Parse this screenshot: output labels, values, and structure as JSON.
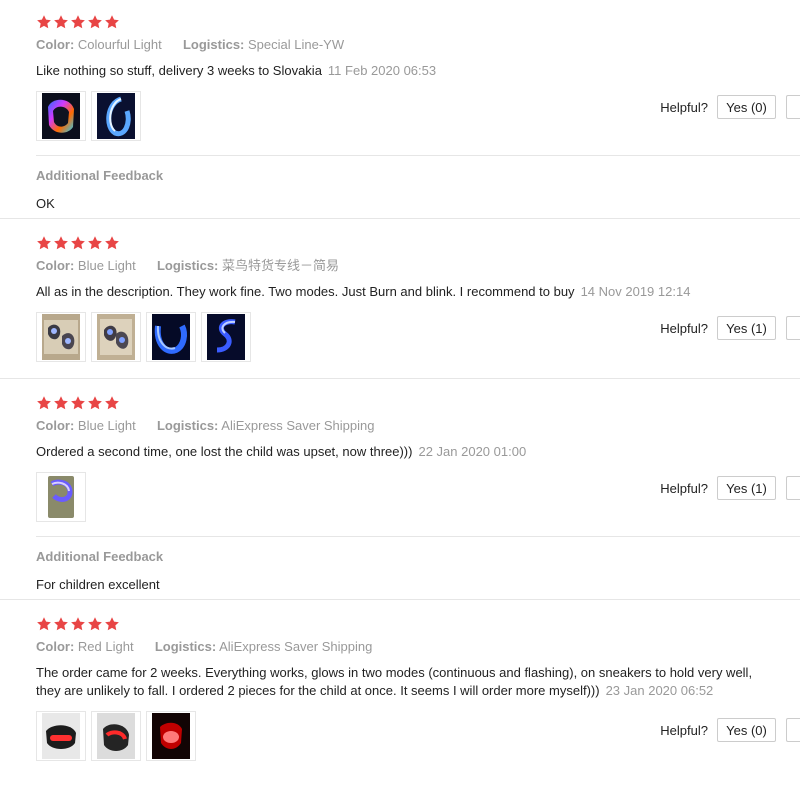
{
  "colors": {
    "star": "#e84545",
    "muted": "#999999",
    "text": "#222222",
    "border": "#e6e6e6"
  },
  "icons": {
    "rating": "star-icon"
  },
  "reviews": [
    {
      "stars": 5,
      "color_label": "Color:",
      "color_value": "Colourful Light",
      "logistics_label": "Logistics:",
      "logistics_value": "Special Line-YW",
      "text": "Like nothing so stuff, delivery 3 weeks to Slovakia",
      "date": "11 Feb 2020 06:53",
      "photos": [
        "rainbow-light-clip-photo",
        "blue-light-clip-photo"
      ],
      "helpful_label": "Helpful?",
      "yes_label": "Yes (0)",
      "additional_title": "Additional Feedback",
      "additional_text": "OK"
    },
    {
      "stars": 5,
      "color_label": "Color:",
      "color_value": "Blue Light",
      "logistics_label": "Logistics:",
      "logistics_value": "菜鸟特货专线－简易",
      "text": "All as in the description. They work fine. Two modes. Just Burn and blink. I recommend to buy",
      "date": "14 Nov 2019 12:14",
      "photos": [
        "packaged-clips-photo",
        "packaged-clips-photo-2",
        "blue-glow-dark-photo",
        "blue-glow-curl-photo"
      ],
      "helpful_label": "Helpful?",
      "yes_label": "Yes (1)"
    },
    {
      "stars": 5,
      "color_label": "Color:",
      "color_value": "Blue Light",
      "logistics_label": "Logistics:",
      "logistics_value": "AliExpress Saver Shipping",
      "text": "Ordered a second time, one lost the child was upset, now three)))",
      "date": "22 Jan 2020 01:00",
      "photos": [
        "blue-clip-on-phone-photo"
      ],
      "helpful_label": "Helpful?",
      "yes_label": "Yes (1)",
      "additional_title": "Additional Feedback",
      "additional_text": "For children excellent"
    },
    {
      "stars": 5,
      "color_label": "Color:",
      "color_value": "Red Light",
      "logistics_label": "Logistics:",
      "logistics_value": "AliExpress Saver Shipping",
      "text": "The order came for 2 weeks. Everything works, glows in two modes (continuous and flashing), on sneakers to hold very well, they are unlikely to fall. I ordered 2 pieces for the child at once. It seems I will order more myself)))",
      "date": "23 Jan 2020 06:52",
      "photos": [
        "red-clip-grey-photo",
        "red-clip-grey-photo-2",
        "red-glow-dark-photo"
      ],
      "helpful_label": "Helpful?",
      "yes_label": "Yes (0)"
    }
  ]
}
